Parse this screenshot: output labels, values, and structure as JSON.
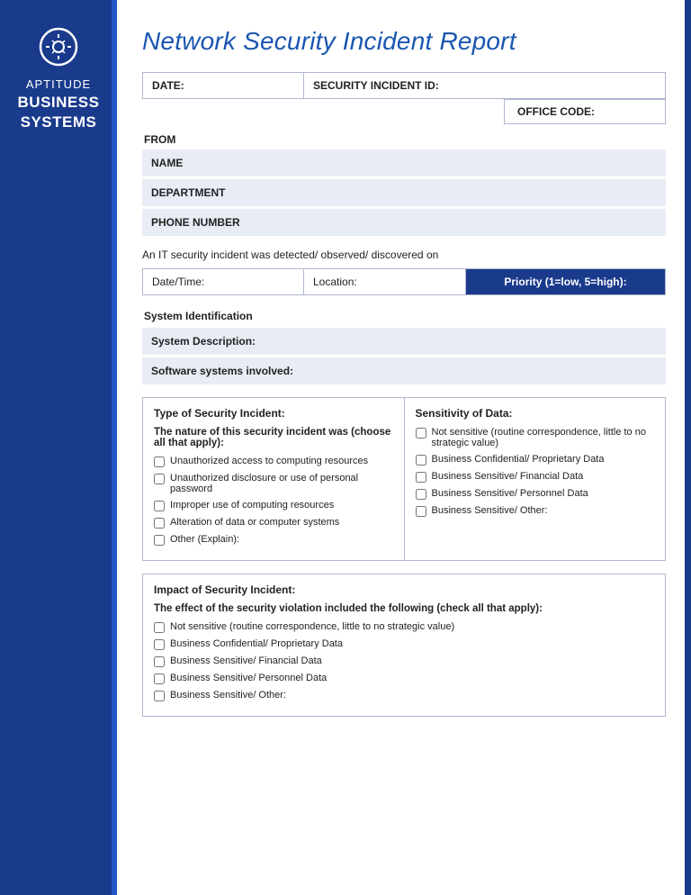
{
  "sidebar": {
    "brand": {
      "aptitude": "APTITUDE",
      "business": "BUSINESS",
      "systems": "SYSTEMS"
    }
  },
  "header": {
    "title": "Network Security Incident Report"
  },
  "fields": {
    "date_label": "DATE:",
    "security_id_label": "SECURITY INCIDENT ID:",
    "office_code_label": "OFFICE CODE:",
    "from_label": "FROM",
    "name_label": "NAME",
    "department_label": "DEPARTMENT",
    "phone_label": "PHONE NUMBER"
  },
  "incident": {
    "detected_line": "An IT security incident was detected/ observed/ discovered on",
    "datetime_label": "Date/Time:",
    "location_label": "Location:",
    "priority_label": "Priority (1=low, 5=high):"
  },
  "system": {
    "section_title": "System Identification",
    "description_label": "System Description:",
    "software_label": "Software systems involved:"
  },
  "security_incident": {
    "col_header": "Type of Security Incident:",
    "nature_header": "The nature of this security incident was (choose all that apply):",
    "checkboxes": [
      "Unauthorized access to computing resources",
      "Unauthorized disclosure or use of personal password",
      "Improper use of computing resources",
      "Alteration of data or computer systems",
      "Other (Explain):"
    ]
  },
  "sensitivity": {
    "col_header": "Sensitivity of Data:",
    "checkboxes": [
      "Not sensitive (routine correspondence, little to no strategic value)",
      "Business Confidential/ Proprietary Data",
      "Business Sensitive/ Financial Data",
      "Business Sensitive/ Personnel Data",
      "Business Sensitive/ Other:"
    ]
  },
  "impact": {
    "section_header": "Impact of Security Incident:",
    "effect_header": "The effect of the security violation included the following (check all that apply):",
    "checkboxes": [
      "Not sensitive (routine correspondence, little to no strategic value)",
      "Business Confidential/ Proprietary Data",
      "Business Sensitive/ Financial Data",
      "Business Sensitive/ Personnel Data",
      "Business Sensitive/ Other:"
    ]
  }
}
